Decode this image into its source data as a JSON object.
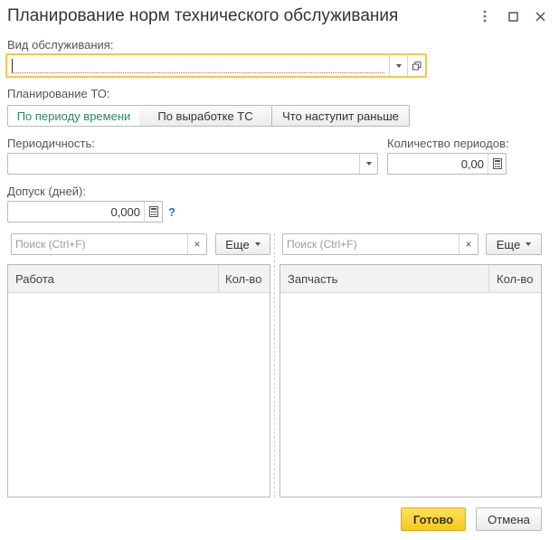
{
  "window": {
    "title": "Планирование норм технического обслуживания",
    "menu_icon": "kebab-menu-icon",
    "maximize_icon": "maximize-icon",
    "close_icon": "close-icon"
  },
  "service_type": {
    "label": "Вид обслуживания:",
    "value": ""
  },
  "planning": {
    "label": "Планирование ТО:",
    "options": [
      {
        "label": "По периоду времени",
        "active": true
      },
      {
        "label": "По выработке ТС",
        "active": false
      },
      {
        "label": "Что наступит раньше",
        "active": false
      }
    ]
  },
  "periodicity": {
    "label": "Периодичность:",
    "value": ""
  },
  "period_count": {
    "label": "Количество периодов:",
    "value": "0,00"
  },
  "tolerance": {
    "label": "Допуск (дней):",
    "value": "0,000",
    "help": "?"
  },
  "left_panel": {
    "search_placeholder": "Поиск (Ctrl+F)",
    "clear": "×",
    "more_label": "Еще",
    "columns": [
      "Работа",
      "Кол-во"
    ]
  },
  "right_panel": {
    "search_placeholder": "Поиск (Ctrl+F)",
    "clear": "×",
    "more_label": "Еще",
    "columns": [
      "Запчасть",
      "Кол-во"
    ]
  },
  "footer": {
    "ok_label": "Готово",
    "cancel_label": "Отмена"
  },
  "colors": {
    "accent_yellow": "#f7c818",
    "focus_border": "#f3c64c",
    "active_segment_text": "#2a8b57"
  }
}
